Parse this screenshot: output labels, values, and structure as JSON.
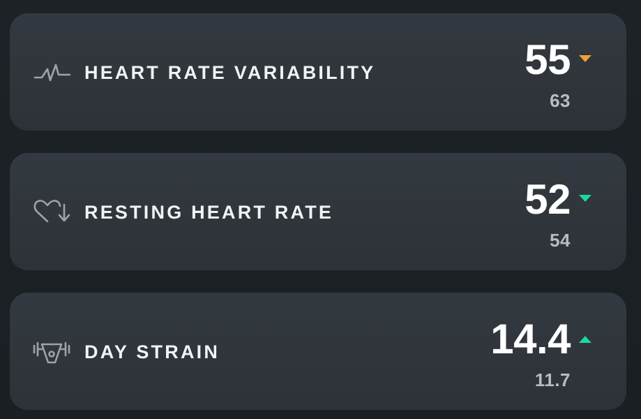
{
  "metrics": [
    {
      "icon": "hrv-pulse-icon",
      "label": "HEART RATE VARIABILITY",
      "value": "55",
      "trend": "down",
      "trend_color": "#f0a032",
      "baseline": "63"
    },
    {
      "icon": "heart-down-arrow-icon",
      "label": "RESTING HEART RATE",
      "value": "52",
      "trend": "down",
      "trend_color": "#1fd6a0",
      "baseline": "54"
    },
    {
      "icon": "strain-dumbbell-icon",
      "label": "DAY STRAIN",
      "value": "14.4",
      "trend": "up",
      "trend_color": "#1fd6a0",
      "baseline": "11.7"
    }
  ]
}
